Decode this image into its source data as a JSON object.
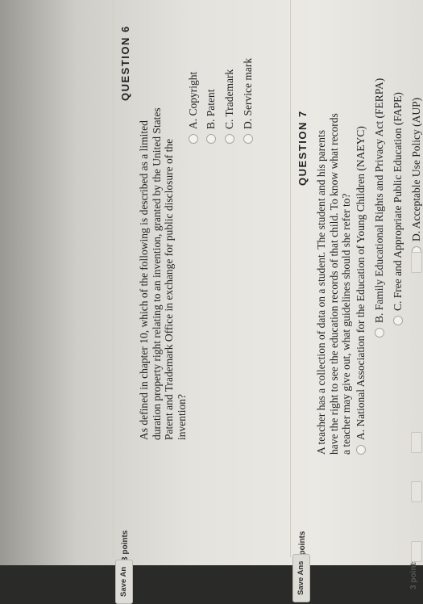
{
  "questions": [
    {
      "heading": "QUESTION 6",
      "points": "3 points",
      "save_label": "Save An",
      "prompt_lines": [
        "As defined in chapter 10, which of the following is described as a limited",
        "duration property right relating to an invention, granted by the United States",
        "Patent and Trademark Office in exchange for public disclosure of the",
        "invention?"
      ],
      "choices": [
        "A. Copyright",
        "B. Patent",
        "C. Trademark",
        "D. Service mark"
      ]
    },
    {
      "heading": "QUESTION 7",
      "points": "3 points",
      "save_label": "Save Ans",
      "prompt_lines": [
        "A teacher has a collection of data on a student. The student and his parents",
        "have the right to see the education records of that child. To know what records",
        "a teacher may give out, what guidelines should she refer to?"
      ],
      "choices": [
        "A. National Association for the Education of Young Children (NAEYC)",
        "B. Family Educational Rights and Privacy Act (FERPA)",
        "C. Free and Appropriate Public Education (FAPE)",
        "D. Acceptable Use Policy (AUP)"
      ]
    }
  ],
  "footer": {
    "partial_label": "3 points"
  },
  "colors": {
    "background": "#ebe9e4",
    "separator": "#cfccc6",
    "text": "#222222"
  }
}
